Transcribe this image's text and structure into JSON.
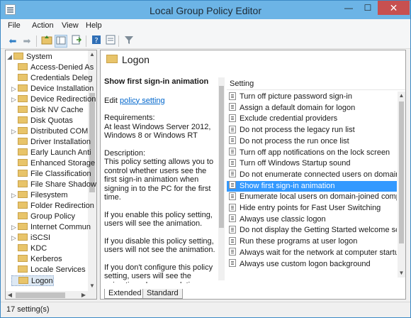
{
  "window": {
    "title": "Local Group Policy Editor"
  },
  "menu": [
    "File",
    "Action",
    "View",
    "Help"
  ],
  "toolbar": [
    "back-arrow-icon",
    "forward-arrow-icon",
    "up-folder-icon",
    "show-hide-tree-icon",
    "export-list-icon",
    "help-icon",
    "properties-icon",
    "filter-icon"
  ],
  "tree": {
    "items": [
      {
        "label": "System",
        "expander": "◢",
        "selected": false
      },
      {
        "label": "Access-Denied As",
        "expander": "",
        "selected": false
      },
      {
        "label": "Credentials Deleg",
        "expander": "",
        "selected": false
      },
      {
        "label": "Device Installation",
        "expander": "▷",
        "selected": false
      },
      {
        "label": "Device Redirection",
        "expander": "▷",
        "selected": false
      },
      {
        "label": "Disk NV Cache",
        "expander": "",
        "selected": false
      },
      {
        "label": "Disk Quotas",
        "expander": "",
        "selected": false
      },
      {
        "label": "Distributed COM",
        "expander": "▷",
        "selected": false
      },
      {
        "label": "Driver Installation",
        "expander": "",
        "selected": false
      },
      {
        "label": "Early Launch Anti",
        "expander": "",
        "selected": false
      },
      {
        "label": "Enhanced Storage",
        "expander": "",
        "selected": false
      },
      {
        "label": "File Classification",
        "expander": "",
        "selected": false
      },
      {
        "label": "File Share Shadow",
        "expander": "",
        "selected": false
      },
      {
        "label": "Filesystem",
        "expander": "▷",
        "selected": false
      },
      {
        "label": "Folder Redirection",
        "expander": "",
        "selected": false
      },
      {
        "label": "Group Policy",
        "expander": "",
        "selected": false
      },
      {
        "label": "Internet Commun",
        "expander": "▷",
        "selected": false
      },
      {
        "label": "iSCSI",
        "expander": "▷",
        "selected": false
      },
      {
        "label": "KDC",
        "expander": "",
        "selected": false
      },
      {
        "label": "Kerberos",
        "expander": "",
        "selected": false
      },
      {
        "label": "Locale Services",
        "expander": "",
        "selected": false
      },
      {
        "label": "Logon",
        "expander": "",
        "selected": true
      }
    ]
  },
  "pane": {
    "title": "Logon",
    "description": {
      "title": "Show first sign-in animation",
      "edit_prefix": "Edit",
      "edit_link": "policy setting",
      "requirements_label": "Requirements:",
      "requirements_text": "At least Windows Server 2012, Windows 8 or Windows RT",
      "description_label": "Description:",
      "paragraphs": [
        "This policy setting allows you to control whether users see the first sign-in animation when signing in to the PC for the first time.",
        "If you enable this policy setting, users will see the animation.",
        "If you disable this policy setting, users will not see the animation.",
        "If you don't configure this policy setting, users will see the animation when completing"
      ]
    },
    "list_header": "Setting",
    "settings": [
      {
        "label": "Turn off picture password sign-in",
        "selected": false
      },
      {
        "label": "Assign a default domain for logon",
        "selected": false
      },
      {
        "label": "Exclude credential providers",
        "selected": false
      },
      {
        "label": "Do not process the legacy run list",
        "selected": false
      },
      {
        "label": "Do not process the run once list",
        "selected": false
      },
      {
        "label": "Turn off app notifications on the lock screen",
        "selected": false
      },
      {
        "label": "Turn off Windows Startup sound",
        "selected": false
      },
      {
        "label": "Do not enumerate connected users on domain-joi",
        "selected": false
      },
      {
        "label": "Show first sign-in animation",
        "selected": true
      },
      {
        "label": "Enumerate local users on domain-joined compute",
        "selected": false
      },
      {
        "label": "Hide entry points for Fast User Switching",
        "selected": false
      },
      {
        "label": "Always use classic logon",
        "selected": false
      },
      {
        "label": "Do not display the Getting Started welcome screen",
        "selected": false
      },
      {
        "label": "Run these programs at user logon",
        "selected": false
      },
      {
        "label": "Always wait for the network at computer startup ar",
        "selected": false
      },
      {
        "label": "Always use custom logon background",
        "selected": false
      }
    ],
    "tabs": [
      {
        "label": "Extended",
        "active": true
      },
      {
        "label": "Standard",
        "active": false
      }
    ]
  },
  "status": {
    "text": "17 setting(s)"
  },
  "colors": {
    "titlebar": "#6cb4e6",
    "selection": "#3399ff",
    "close": "#c75050",
    "link": "#0066cc"
  }
}
